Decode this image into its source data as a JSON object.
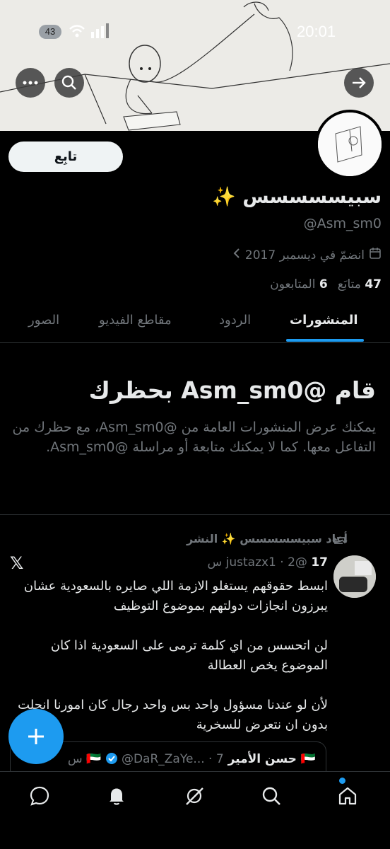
{
  "status_bar": {
    "time": "20:01",
    "battery": "43"
  },
  "profile": {
    "name": "سبيسسسسس ✨",
    "handle": "@Asm_sm0",
    "joined": "انضمّ في ديسمبر 2017",
    "following_count": "47",
    "following_label": "متابَع",
    "followers_count": "6",
    "followers_label": "المتابعون",
    "follow_button": "تابِع"
  },
  "tabs": [
    {
      "label": "المنشورات",
      "active": true
    },
    {
      "label": "الردود",
      "active": false
    },
    {
      "label": "مقاطع الفيديو",
      "active": false
    },
    {
      "label": "الصور",
      "active": false
    }
  ],
  "blocked": {
    "title": "قام @Asm_sm0 بحظرك",
    "description": "يمكنك عرض المنشورات العامة من @Asm_sm0، مع حظرك من التفاعل معها. كما لا يمكنك متابعة أو مراسلة @Asm_sm0."
  },
  "tweet": {
    "repost_label": "أعاد سبيسسسسس ✨ النشر",
    "author": "17",
    "handle": "@justazx1",
    "time": "2 س",
    "text": "ابسط حقوقهم يستغلو الازمة اللي صايره بالسعودية عشان يبرزون انجازات دولتهم بموضوع التوظيف\n\nلن اتحسس من اي كلمة ترمى على السعودية اذا كان الموضوع يخص العطالة\n\nلأن لو عندنا مسؤول واحد بس واحد رجال كان امورنا انحلت بدون ان نتعرض للسخرية"
  },
  "quote": {
    "name": "🇦🇪 حسن الأمير 🇦🇪",
    "handle": "@DaR_ZaYe...",
    "time": "7 س"
  },
  "colors": {
    "accent": "#1d9bf0",
    "background": "#000000",
    "muted": "#71767b"
  }
}
